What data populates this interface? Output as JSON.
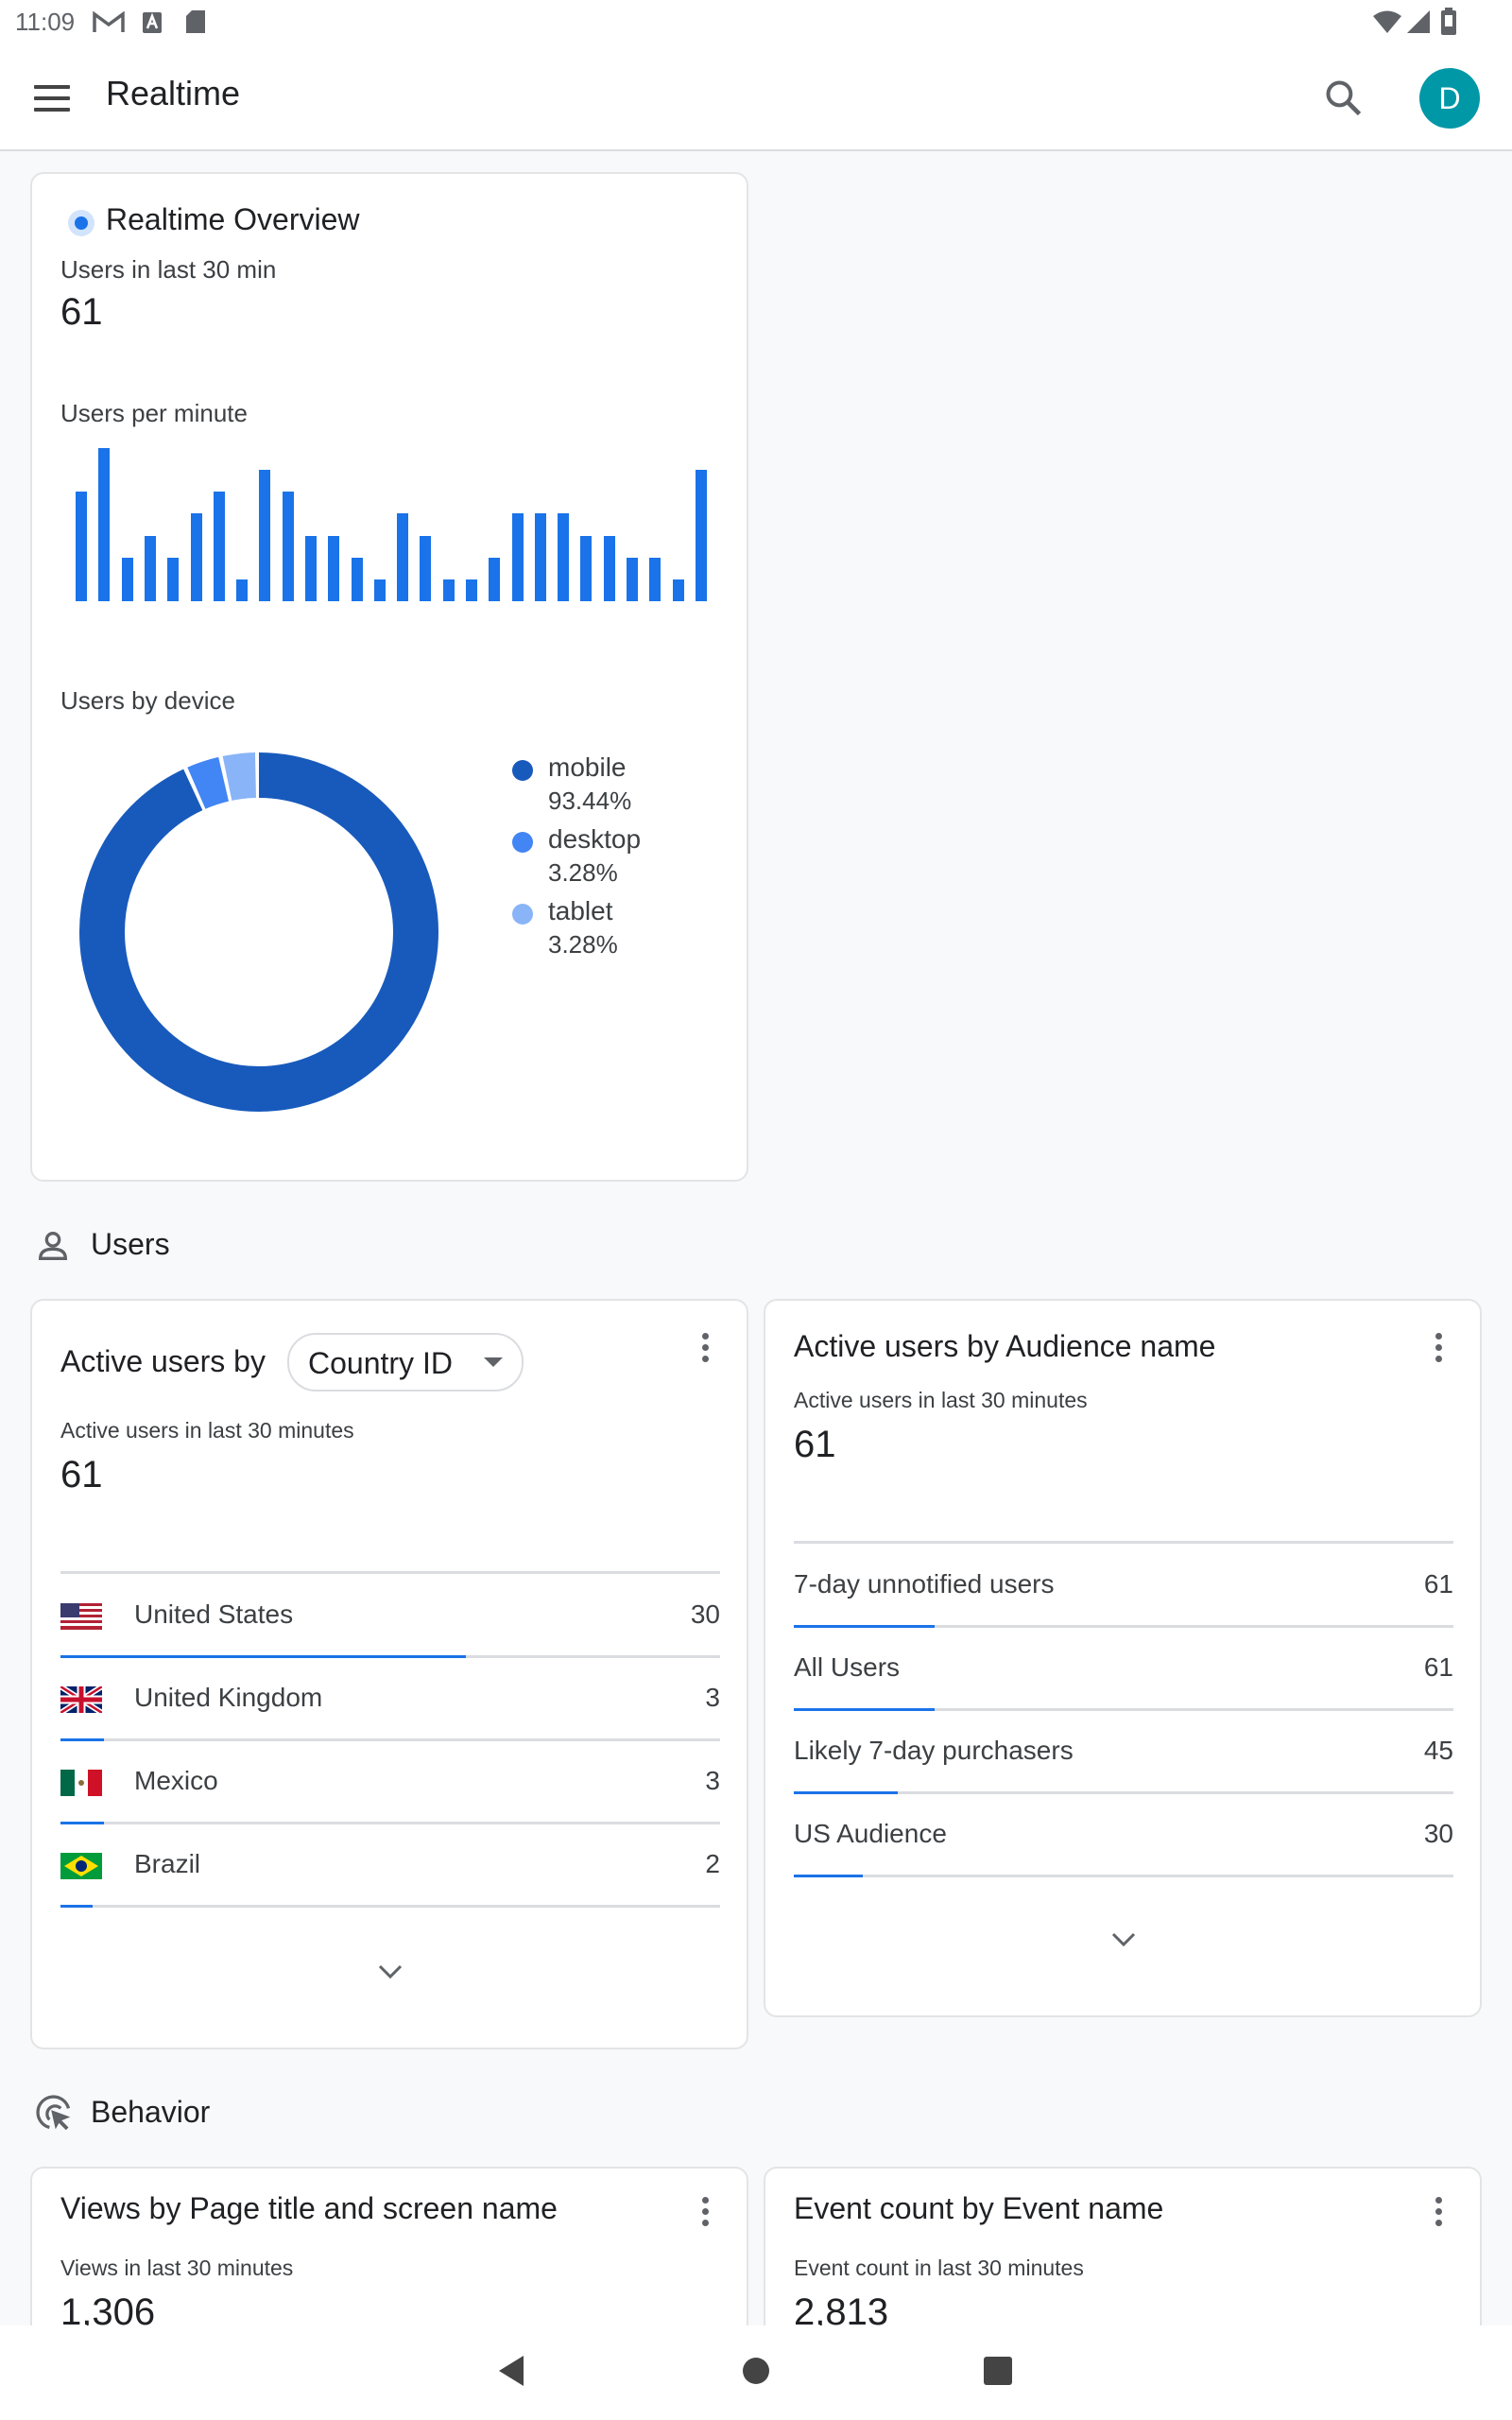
{
  "status_bar": {
    "time": "11:09"
  },
  "app_bar": {
    "title": "Realtime",
    "avatar_letter": "D"
  },
  "overview": {
    "title": "Realtime Overview",
    "users_label": "Users in last 30 min",
    "users_value": "61",
    "per_minute_label": "Users per minute",
    "device_label": "Users by device"
  },
  "chart_data": [
    {
      "type": "bar",
      "title": "Users per minute",
      "values": [
        5,
        7,
        2,
        3,
        2,
        4,
        5,
        1,
        6,
        5,
        3,
        3,
        2,
        1,
        4,
        3,
        1,
        1,
        2,
        4,
        4,
        4,
        3,
        3,
        2,
        2,
        1,
        6
      ],
      "color": "#1a73e8"
    },
    {
      "type": "pie",
      "title": "Users by device",
      "slices": [
        {
          "name": "mobile",
          "value": 93.44,
          "label": "93.44%",
          "color": "#185abc"
        },
        {
          "name": "desktop",
          "value": 3.28,
          "label": "3.28%",
          "color": "#4285f4"
        },
        {
          "name": "tablet",
          "value": 3.28,
          "label": "3.28%",
          "color": "#8ab4f8"
        }
      ]
    }
  ],
  "users_section": {
    "label": "Users"
  },
  "country_card": {
    "title_prefix": "Active users by",
    "dimension": "Country ID",
    "subtitle": "Active users in last 30 minutes",
    "value": "61",
    "rows": [
      {
        "label": "United States",
        "value": "30",
        "fraction": 0.6148
      },
      {
        "label": "United Kingdom",
        "value": "3",
        "fraction": 0.0656
      },
      {
        "label": "Mexico",
        "value": "3",
        "fraction": 0.0656
      },
      {
        "label": "Brazil",
        "value": "2",
        "fraction": 0.0492
      }
    ]
  },
  "audience_card": {
    "title": "Active users by Audience name",
    "subtitle": "Active users in last 30 minutes",
    "value": "61",
    "rows": [
      {
        "label": "7-day unnotified users",
        "value": "61",
        "fraction": 0.2133
      },
      {
        "label": "All Users",
        "value": "61",
        "fraction": 0.2133
      },
      {
        "label": "Likely 7-day purchasers",
        "value": "45",
        "fraction": 0.1573
      },
      {
        "label": "US Audience",
        "value": "30",
        "fraction": 0.1049
      }
    ]
  },
  "behavior_section": {
    "label": "Behavior"
  },
  "views_card": {
    "title": "Views by Page title and screen name",
    "subtitle": "Views in last 30 minutes",
    "value": "1,306"
  },
  "events_card": {
    "title": "Event count by Event name",
    "subtitle": "Event count in last 30 minutes",
    "value": "2,813"
  },
  "colors": {
    "accent": "#1a73e8",
    "avatar": "#0097a7"
  }
}
